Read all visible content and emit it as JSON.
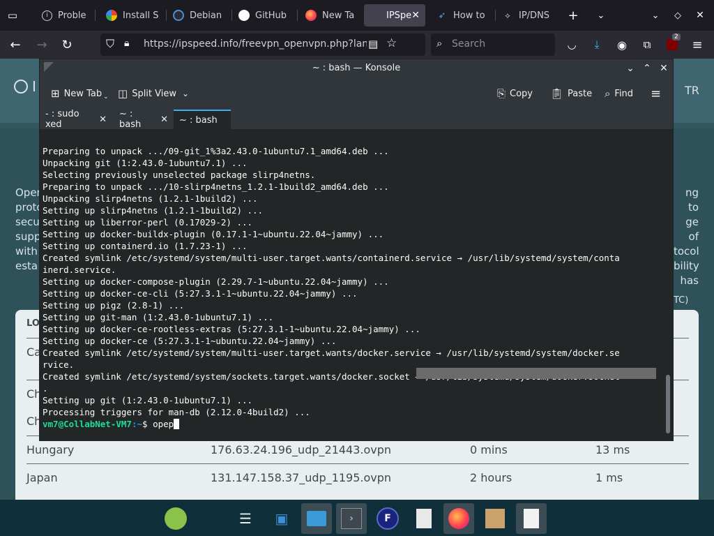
{
  "firefox": {
    "tabs": [
      {
        "title": "Probler",
        "icon": "circle-i-icon"
      },
      {
        "title": "Install S",
        "icon": "google-icon"
      },
      {
        "title": "Debian",
        "icon": "debian-icon"
      },
      {
        "title": "GitHub",
        "icon": "github-icon"
      },
      {
        "title": "New Ta",
        "icon": "firefox-icon"
      },
      {
        "title": "IPSpe",
        "icon": "ipspeed-icon",
        "active": true
      },
      {
        "title": "How to",
        "icon": "bird-icon"
      },
      {
        "title": "IP/DNS",
        "icon": "ipdns-icon"
      }
    ],
    "url": "https://ipspeed.info/freevpn_openvpn.php?lang",
    "search_placeholder": "Search",
    "addon_badge": "2"
  },
  "webpage": {
    "header_letter": "I",
    "header_right": "TR",
    "para_left": [
      "Oper",
      "proto",
      "secu",
      "supp",
      "with",
      "esta"
    ],
    "para_right": [
      "ng to",
      "ge of",
      "tocol",
      "bility",
      "has"
    ],
    "tc_note": "TC)",
    "table_header_fragment": "LO",
    "row_fragments": [
      "Ca",
      "Ch",
      "Ch"
    ],
    "rows": [
      {
        "country": "Hungary",
        "file": "176.63.24.196_udp_21443.ovpn",
        "uptime": "0 mins",
        "ping": "13 ms"
      },
      {
        "country": "Japan",
        "file": "131.147.158.37_udp_1195.ovpn",
        "uptime": "2 hours",
        "ping": "1 ms"
      }
    ]
  },
  "konsole": {
    "title": "~ : bash — Konsole",
    "toolbar": {
      "new_tab": "New Tab",
      "split_view": "Split View",
      "copy": "Copy",
      "paste": "Paste",
      "find": "Find"
    },
    "tabs": [
      {
        "label": "- : sudo xed"
      },
      {
        "label": "~ : bash"
      },
      {
        "label": "~ : bash",
        "active": true
      }
    ],
    "lines": [
      "Preparing to unpack .../09-git_1%3a2.43.0-1ubuntu7.1_amd64.deb ...",
      "Unpacking git (1:2.43.0-1ubuntu7.1) ...",
      "Selecting previously unselected package slirp4netns.",
      "Preparing to unpack .../10-slirp4netns_1.2.1-1build2_amd64.deb ...",
      "Unpacking slirp4netns (1.2.1-1build2) ...",
      "Setting up slirp4netns (1.2.1-1build2) ...",
      "Setting up liberror-perl (0.17029-2) ...",
      "Setting up docker-buildx-plugin (0.17.1-1~ubuntu.22.04~jammy) ...",
      "Setting up containerd.io (1.7.23-1) ...",
      "Created symlink /etc/systemd/system/multi-user.target.wants/containerd.service → /usr/lib/systemd/system/conta",
      "inerd.service.",
      "Setting up docker-compose-plugin (2.29.7-1~ubuntu.22.04~jammy) ...",
      "Setting up docker-ce-cli (5:27.3.1-1~ubuntu.22.04~jammy) ...",
      "Setting up pigz (2.8-1) ...",
      "Setting up git-man (1:2.43.0-1ubuntu7.1) ...",
      "Setting up docker-ce-rootless-extras (5:27.3.1-1~ubuntu.22.04~jammy) ...",
      "Setting up docker-ce (5:27.3.1-1~ubuntu.22.04~jammy) ...",
      "Created symlink /etc/systemd/system/multi-user.target.wants/docker.service → /usr/lib/systemd/system/docker.se",
      "rvice.",
      "Created symlink /etc/systemd/system/sockets.target.wants/docker.socket → /usr/lib/systemd/system/docker.socket",
      ".",
      "Setting up git (1:2.43.0-1ubuntu7.1) ...",
      "Processing triggers for man-db (2.12.0-4build2) ..."
    ],
    "prompt": {
      "user_host": "vm7@CollabNet-VM7",
      "path": ":~",
      "symbol": "$ ",
      "input": "opep"
    }
  },
  "colors": {
    "prompt_user": "#1cdc9a",
    "prompt_path": "#1d99f3",
    "tab_accent": "#3daee9",
    "panel": "#0f2f3a"
  },
  "panel": {
    "items": [
      {
        "name": "mint-menu-icon"
      },
      {
        "name": "settings-sliders-icon"
      },
      {
        "name": "software-store-icon"
      },
      {
        "name": "file-manager-icon"
      },
      {
        "name": "terminal-icon"
      },
      {
        "name": "fdm-icon"
      },
      {
        "name": "text-file-icon"
      },
      {
        "name": "firefox-icon"
      },
      {
        "name": "archive-manager-icon"
      },
      {
        "name": "document-viewer-icon"
      }
    ]
  }
}
